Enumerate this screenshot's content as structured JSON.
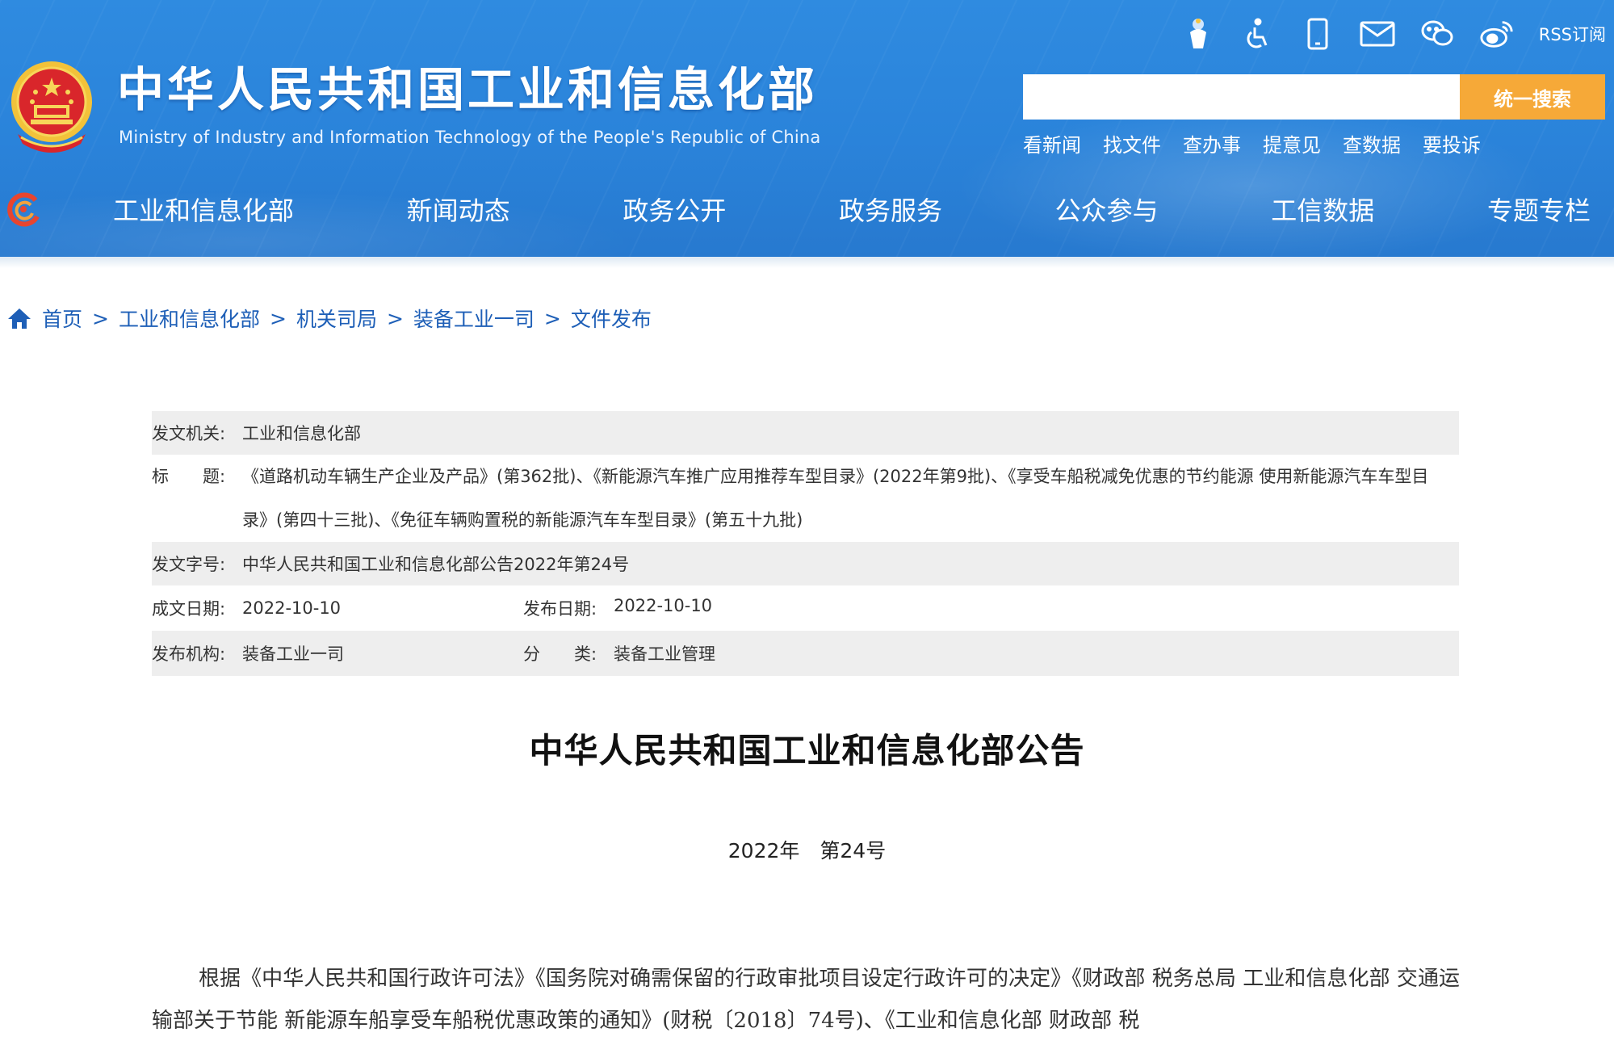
{
  "header": {
    "site_title": "中华人民共和国工业和信息化部",
    "site_subtitle": "Ministry of Industry and Information Technology of the People's Republic of China",
    "rss_label": "RSS订阅",
    "search": {
      "placeholder": "",
      "button_label": "统一搜索"
    },
    "quick_links": [
      "看新闻",
      "找文件",
      "查办事",
      "提意见",
      "查数据",
      "要投诉"
    ],
    "nav": [
      "工业和信息化部",
      "新闻动态",
      "政务公开",
      "政务服务",
      "公众参与",
      "工信数据",
      "专题专栏"
    ],
    "colors": {
      "header_bg": "#2a83da",
      "search_button": "#f6a938"
    }
  },
  "breadcrumb": [
    "首页",
    "工业和信息化部",
    "机关司局",
    "装备工业一司",
    "文件发布"
  ],
  "meta": {
    "agency_label": "发文机关:",
    "agency": "工业和信息化部",
    "title_label": "标　　题:",
    "title": "《道路机动车辆生产企业及产品》(第362批)、《新能源汽车推广应用推荐车型目录》(2022年第9批)、《享受车船税减免优惠的节约能源 使用新能源汽车车型目录》(第四十三批)、《免征车辆购置税的新能源汽车车型目录》(第五十九批)",
    "docno_label": "发文字号:",
    "docno": "中华人民共和国工业和信息化部公告2022年第24号",
    "written_label": "成文日期:",
    "written_date": "2022-10-10",
    "published_label": "发布日期:",
    "published_date": "2022-10-10",
    "org_label": "发布机构:",
    "org": "装备工业一司",
    "category_label": "分　　类:",
    "category": "装备工业管理"
  },
  "document": {
    "title": "中华人民共和国工业和信息化部公告",
    "number": "2022年　第24号",
    "paragraph": "根据《中华人民共和国行政许可法》《国务院对确需保留的行政审批项目设定行政许可的决定》《财政部 税务总局 工业和信息化部 交通运输部关于节能 新能源车船享受车船税优惠政策的通知》(财税〔2018〕74号)、《工业和信息化部 财政部 税"
  }
}
